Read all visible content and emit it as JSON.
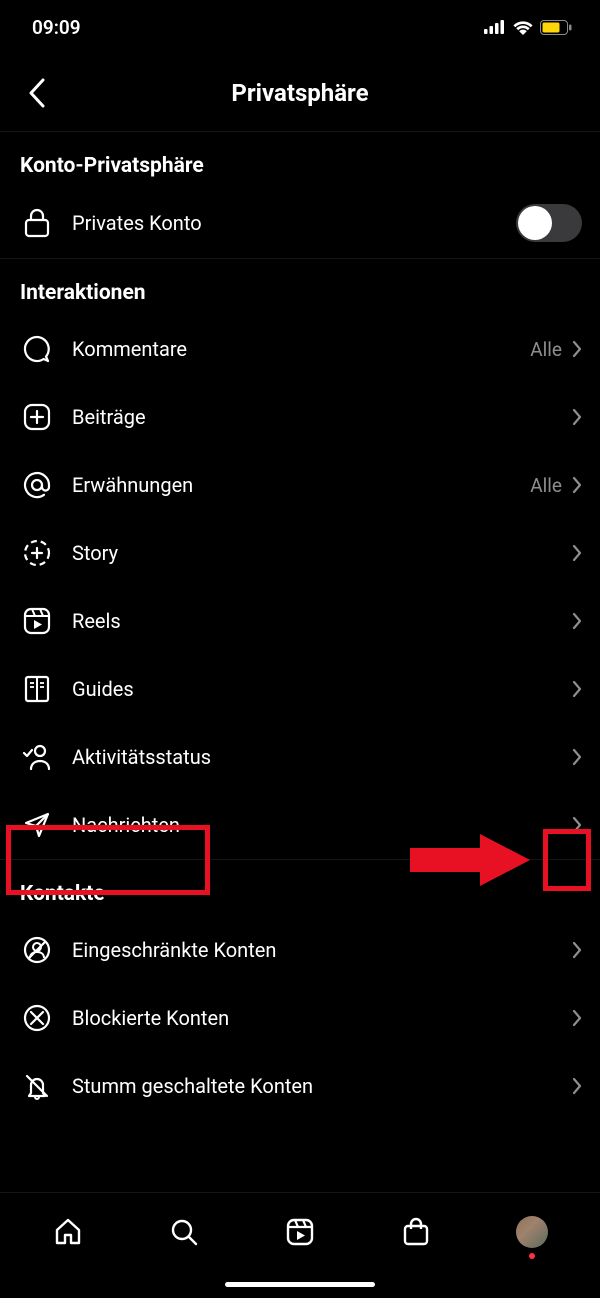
{
  "status": {
    "time": "09:09"
  },
  "header": {
    "title": "Privatsphäre"
  },
  "sections": {
    "account": {
      "title": "Konto-Privatsphäre",
      "private_label": "Privates Konto"
    },
    "interactions": {
      "title": "Interaktionen",
      "items": [
        {
          "label": "Kommentare",
          "value": "Alle"
        },
        {
          "label": "Beiträge",
          "value": ""
        },
        {
          "label": "Erwähnungen",
          "value": "Alle"
        },
        {
          "label": "Story",
          "value": ""
        },
        {
          "label": "Reels",
          "value": ""
        },
        {
          "label": "Guides",
          "value": ""
        },
        {
          "label": "Aktivitätsstatus",
          "value": ""
        },
        {
          "label": "Nachrichten",
          "value": ""
        }
      ]
    },
    "contacts": {
      "title": "Kontakte",
      "items": [
        {
          "label": "Eingeschränkte Konten"
        },
        {
          "label": "Blockierte Konten"
        },
        {
          "label": "Stumm geschaltete Konten"
        }
      ]
    }
  }
}
